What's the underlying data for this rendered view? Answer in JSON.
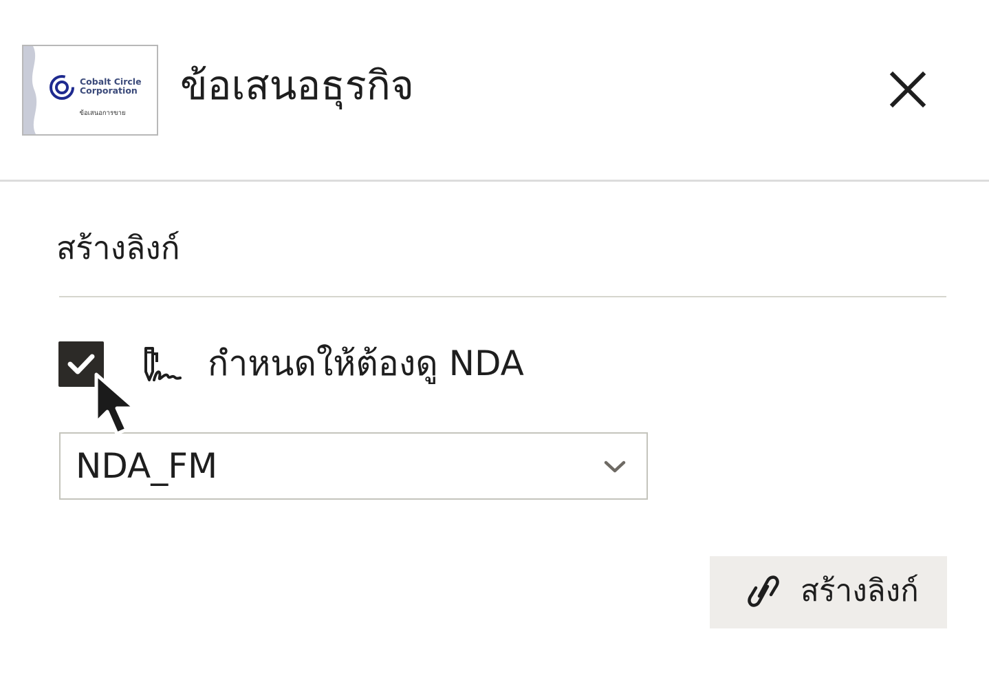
{
  "header": {
    "document_title": "ข้อเสนอธุรกิจ",
    "thumbnail": {
      "company_name_line1": "Cobalt Circle",
      "company_name_line2": "Corporation",
      "caption": "ข้อเสนอการขาย"
    },
    "close_icon": "close-icon"
  },
  "section": {
    "title": "สร้างลิงก์"
  },
  "nda": {
    "checked": true,
    "label": "กำหนดให้ต้องดู NDA",
    "icon": "signature-icon"
  },
  "nda_select": {
    "selected_value": "NDA_FM",
    "icon": "chevron-down-icon"
  },
  "create_button": {
    "label": "สร้างลิงก์",
    "icon": "link-icon"
  },
  "colors": {
    "checkbox_fill": "#2c2a27",
    "button_bg": "#efedea",
    "divider": "#d6d6ce",
    "logo_blue": "#1e2a8f"
  }
}
